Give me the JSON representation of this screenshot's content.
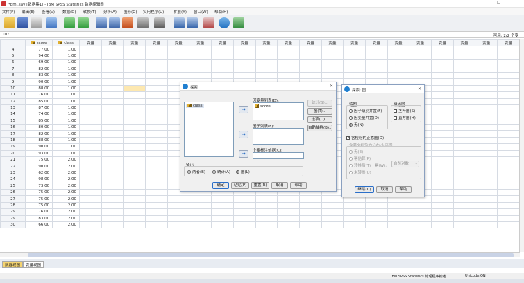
{
  "window": {
    "title": "*bmi.sav [数据集1] - IBM SPSS Statistics 数据编辑器",
    "minimize": "—",
    "maximize": "☐"
  },
  "menu": [
    "文件(F)",
    "编辑(E)",
    "查看(V)",
    "数据(D)",
    "转换(T)",
    "分析(A)",
    "图形(G)",
    "实用程序(U)",
    "扩展(X)",
    "窗口(W)",
    "帮助(H)"
  ],
  "toolbar": {
    "buttons": [
      "open-icon",
      "save-icon",
      "print-icon",
      "dialog-recall-icon",
      "undo-icon",
      "redo-icon",
      "goto-case-icon",
      "goto-variable-icon",
      "variables-icon",
      "run-descriptives-icon",
      "find-icon",
      "insert-cases-icon",
      "insert-variable-icon",
      "split-file-icon",
      "weight-cases-icon",
      "select-cases-icon",
      "value-labels-icon",
      "use-sets-icon"
    ],
    "accent": "#2a6ec4"
  },
  "cellbar": {
    "ref": "10 :",
    "visible": "可用: 2/2 个变"
  },
  "grid": {
    "columns": [
      "score",
      "class",
      "变量",
      "变量",
      "变量",
      "变量",
      "变量",
      "变量",
      "变量",
      "变量",
      "变量",
      "变量",
      "变量",
      "变量",
      "变量",
      "变量",
      "变量",
      "变量",
      "变量",
      "变量",
      "变量",
      "变量"
    ],
    "rows": [
      {
        "n": "4",
        "score": "77.00",
        "class": "1.00"
      },
      {
        "n": "5",
        "score": "94.00",
        "class": "1.00"
      },
      {
        "n": "6",
        "score": "69.00",
        "class": "1.00"
      },
      {
        "n": "7",
        "score": "82.00",
        "class": "1.00"
      },
      {
        "n": "8",
        "score": "83.00",
        "class": "1.00"
      },
      {
        "n": "9",
        "score": "90.00",
        "class": "1.00"
      },
      {
        "n": "10",
        "score": "88.00",
        "class": "1.00"
      },
      {
        "n": "11",
        "score": "76.00",
        "class": "1.00"
      },
      {
        "n": "12",
        "score": "85.00",
        "class": "1.00"
      },
      {
        "n": "13",
        "score": "87.00",
        "class": "1.00"
      },
      {
        "n": "14",
        "score": "74.00",
        "class": "1.00"
      },
      {
        "n": "15",
        "score": "85.00",
        "class": "1.00"
      },
      {
        "n": "16",
        "score": "80.00",
        "class": "1.00"
      },
      {
        "n": "17",
        "score": "82.00",
        "class": "1.00"
      },
      {
        "n": "18",
        "score": "88.00",
        "class": "1.00"
      },
      {
        "n": "19",
        "score": "90.00",
        "class": "1.00"
      },
      {
        "n": "20",
        "score": "93.00",
        "class": "1.00"
      },
      {
        "n": "21",
        "score": "75.00",
        "class": "2.00"
      },
      {
        "n": "22",
        "score": "90.00",
        "class": "2.00"
      },
      {
        "n": "23",
        "score": "62.00",
        "class": "2.00"
      },
      {
        "n": "24",
        "score": "98.00",
        "class": "2.00"
      },
      {
        "n": "25",
        "score": "73.00",
        "class": "2.00"
      },
      {
        "n": "26",
        "score": "75.00",
        "class": "2.00"
      },
      {
        "n": "27",
        "score": "75.00",
        "class": "2.00"
      },
      {
        "n": "28",
        "score": "75.00",
        "class": "2.00"
      },
      {
        "n": "29",
        "score": "76.00",
        "class": "2.00"
      },
      {
        "n": "29",
        "score": "83.00",
        "class": "2.00"
      },
      {
        "n": "30",
        "score": "66.00",
        "class": "2.00"
      }
    ]
  },
  "explore": {
    "title": "探索",
    "source_item": "class",
    "dependent_label": "因变量列表(D):",
    "dependent_item": "score",
    "factor_label": "因子列表(F):",
    "label_cases_label": "个案标注依据(C):",
    "side_buttons": [
      "统计(S)...",
      "图(T)...",
      "选项(O)...",
      "自助抽样(B)..."
    ],
    "output_label": "输出",
    "output_options": [
      "两者(B)",
      "统计(A)",
      "图(L)"
    ],
    "output_selected": "图(L)",
    "bottom_buttons": [
      "确定",
      "粘贴(P)",
      "重置(R)",
      "取消",
      "帮助"
    ]
  },
  "plots": {
    "title": "探索: 图",
    "boxplot_group": "箱图",
    "boxplot_options": [
      "因子级别并置(F)",
      "因变量并置(D)",
      "无(N)"
    ],
    "boxplot_selected": "无(N)",
    "descriptive_group": "描述图",
    "descriptive_options": [
      "茎叶图(S)",
      "直方图(H)"
    ],
    "normality_label": "含检验的正态图(O)",
    "normality_checked": true,
    "spread_group": "含莱文检验的分布-水平图",
    "spread_options": [
      "无(E)",
      "幂估算(P)",
      "转换后(T)",
      "未转换(U)"
    ],
    "power_label": "幂(W):",
    "power_value": "自然对数",
    "buttons": [
      "继续(C)",
      "取消",
      "帮助"
    ]
  },
  "tabs": [
    "数据视图",
    "变量视图"
  ],
  "status": {
    "processor": "IBM SPSS Statistics 处理程序就绪",
    "unicode": "Unicode:ON"
  }
}
